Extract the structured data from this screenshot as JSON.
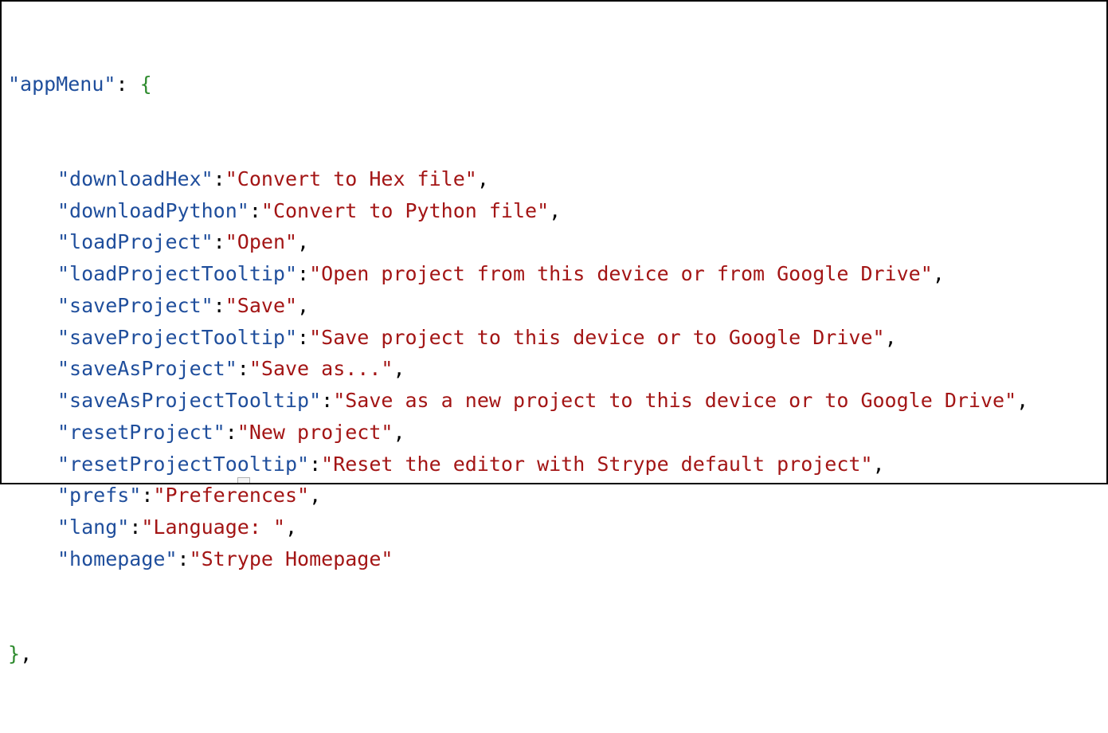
{
  "editor": {
    "open_key": "\"appMenu\"",
    "open_colon": ": ",
    "open_brace": "{",
    "close_brace": "}",
    "close_comma": ",",
    "entries": [
      {
        "key": "\"downloadHex\"",
        "value": "\"Convert to Hex file\""
      },
      {
        "key": "\"downloadPython\"",
        "value": "\"Convert to Python file\""
      },
      {
        "key": "\"loadProject\"",
        "value": "\"Open\""
      },
      {
        "key": "\"loadProjectTooltip\"",
        "value": "\"Open project from this device or from Google Drive\""
      },
      {
        "key": "\"saveProject\"",
        "value": "\"Save\""
      },
      {
        "key": "\"saveProjectTooltip\"",
        "value": "\"Save project to this device or to Google Drive\""
      },
      {
        "key": "\"saveAsProject\"",
        "value": "\"Save as...\""
      },
      {
        "key": "\"saveAsProjectTooltip\"",
        "value": "\"Save as a new project to this device or to Google Drive\""
      },
      {
        "key": "\"resetProject\"",
        "value": "\"New project\""
      },
      {
        "key": "\"resetProjectTooltip\"",
        "value": "\"Reset the editor with Strype default project\""
      },
      {
        "key": "\"prefs\"",
        "value": "\"Preferences\""
      },
      {
        "key": "\"lang\"",
        "value": "\"Language: \""
      },
      {
        "key": "\"homepage\"",
        "value": "\"Strype Homepage\"",
        "last": true
      }
    ]
  },
  "colors": {
    "key": "#1f4e9c",
    "string": "#a31515",
    "brace": "#2e8b2e",
    "border": "#000000"
  }
}
